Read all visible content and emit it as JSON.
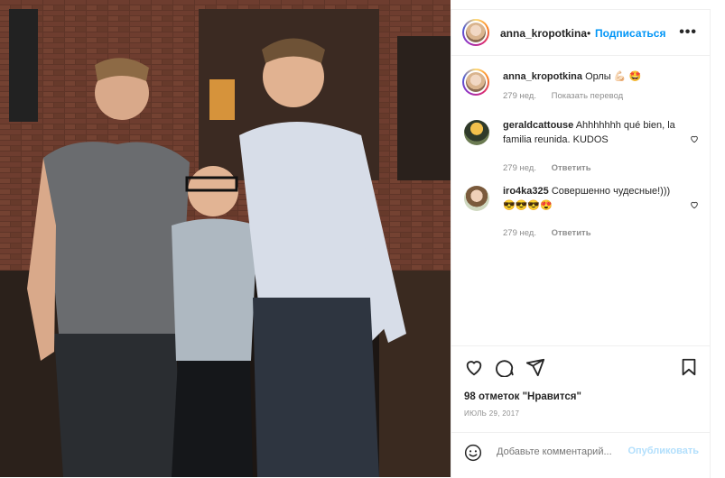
{
  "post": {
    "author": "anna_kropotkina",
    "follow_label": "Подписаться",
    "more_label": "•••",
    "caption_text": "Орлы 💪🏻 🤩",
    "caption_time": "279 нед.",
    "translate_label": "Показать перевод"
  },
  "comments": [
    {
      "user": "geraldcattouse",
      "text": "Ahhhhhhh qué bien, la familia reunida. KUDOS",
      "time": "279 нед.",
      "reply": "Ответить"
    },
    {
      "user": "iro4ka325",
      "text": "Совершенно чудесные!)))😎😎😎😍",
      "time": "279 нед.",
      "reply": "Ответить"
    }
  ],
  "actions": {
    "likes": "98 отметок \"Нравится\"",
    "date": "ИЮЛЬ 29, 2017"
  },
  "add_comment": {
    "placeholder": "Добавьте комментарий...",
    "publish": "Опубликовать"
  },
  "colors": {
    "accent": "#0095f6",
    "muted": "#8e8e8e",
    "publish_disabled": "#b2dffc"
  },
  "icons": [
    "heart-icon",
    "comment-icon",
    "share-icon",
    "bookmark-icon",
    "emoji-icon"
  ]
}
